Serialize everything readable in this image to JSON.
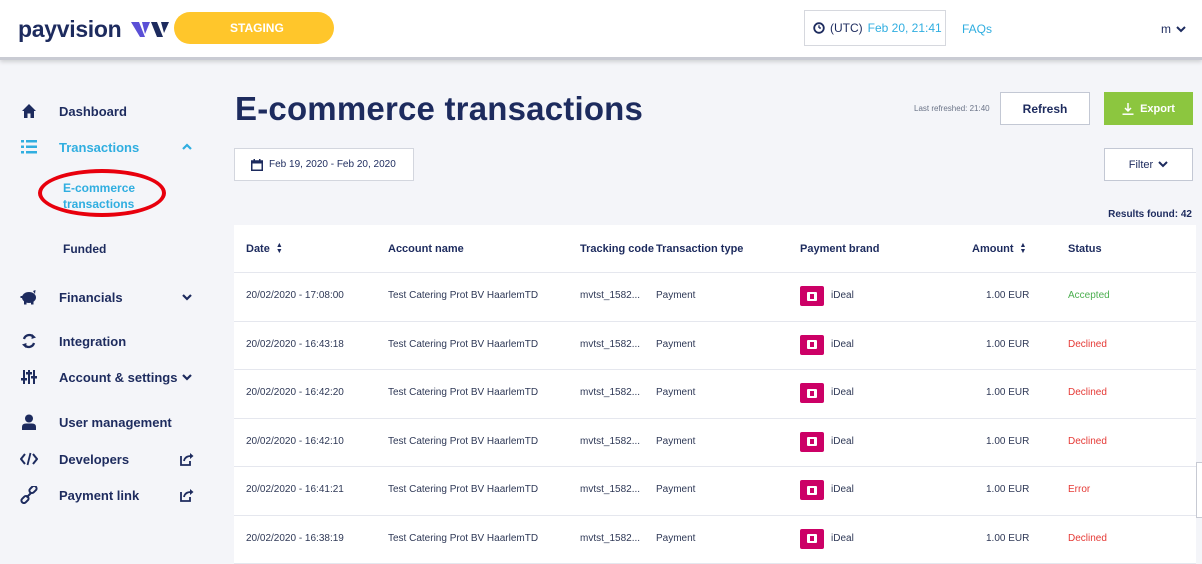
{
  "header": {
    "logo_text": "payvision",
    "env_label": "STAGING",
    "clock_utc": "(UTC)",
    "clock_datetime": "Feb 20, 21:41",
    "faqs_label": "FAQs",
    "user_label": "m"
  },
  "sidebar": {
    "items": [
      {
        "label": "Dashboard",
        "icon": "home-icon"
      },
      {
        "label": "Transactions",
        "icon": "list-icon"
      },
      {
        "label": "E-commerce transactions"
      },
      {
        "label": "Funded"
      },
      {
        "label": "Financials",
        "icon": "piggy-bank-icon"
      },
      {
        "label": "Integration",
        "icon": "refresh-cycle-icon"
      },
      {
        "label": "Account & settings",
        "icon": "sliders-icon"
      },
      {
        "label": "User management",
        "icon": "user-icon"
      },
      {
        "label": "Developers",
        "icon": "code-icon"
      },
      {
        "label": "Payment link",
        "icon": "link-icon"
      }
    ]
  },
  "main": {
    "title": "E-commerce transactions",
    "last_refreshed": "Last refreshed: 21:40",
    "refresh_label": "Refresh",
    "export_label": "Export",
    "date_range": "Feb 19, 2020 - Feb 20, 2020",
    "filter_label": "Filter",
    "results_found": "Results found: 42"
  },
  "table": {
    "columns": [
      "Date",
      "Account name",
      "Tracking code",
      "Transaction type",
      "Payment brand",
      "Amount",
      "Status"
    ],
    "rows": [
      {
        "date": "20/02/2020 - 17:08:00",
        "account": "Test Catering Prot BV HaarlemTD",
        "tracking": "mvtst_1582...",
        "type": "Payment",
        "brand": "iDeal",
        "amount": "1.00 EUR",
        "status": "Accepted"
      },
      {
        "date": "20/02/2020 - 16:43:18",
        "account": "Test Catering Prot BV HaarlemTD",
        "tracking": "mvtst_1582...",
        "type": "Payment",
        "brand": "iDeal",
        "amount": "1.00 EUR",
        "status": "Declined"
      },
      {
        "date": "20/02/2020 - 16:42:20",
        "account": "Test Catering Prot BV HaarlemTD",
        "tracking": "mvtst_1582...",
        "type": "Payment",
        "brand": "iDeal",
        "amount": "1.00 EUR",
        "status": "Declined"
      },
      {
        "date": "20/02/2020 - 16:42:10",
        "account": "Test Catering Prot BV HaarlemTD",
        "tracking": "mvtst_1582...",
        "type": "Payment",
        "brand": "iDeal",
        "amount": "1.00 EUR",
        "status": "Declined"
      },
      {
        "date": "20/02/2020 - 16:41:21",
        "account": "Test Catering Prot BV HaarlemTD",
        "tracking": "mvtst_1582...",
        "type": "Payment",
        "brand": "iDeal",
        "amount": "1.00 EUR",
        "status": "Error"
      },
      {
        "date": "20/02/2020 - 16:38:19",
        "account": "Test Catering Prot BV HaarlemTD",
        "tracking": "mvtst_1582...",
        "type": "Payment",
        "brand": "iDeal",
        "amount": "1.00 EUR",
        "status": "Declined"
      }
    ]
  },
  "colors": {
    "navy": "#1d2b5e",
    "accent_blue": "#30aee0",
    "staging_yellow": "#ffc62b",
    "export_green": "#8cc63f",
    "ideal_pink": "#cc0066",
    "accepted_green": "#4caf50",
    "declined_red": "#e53935",
    "highlight_red": "#e8000d"
  }
}
